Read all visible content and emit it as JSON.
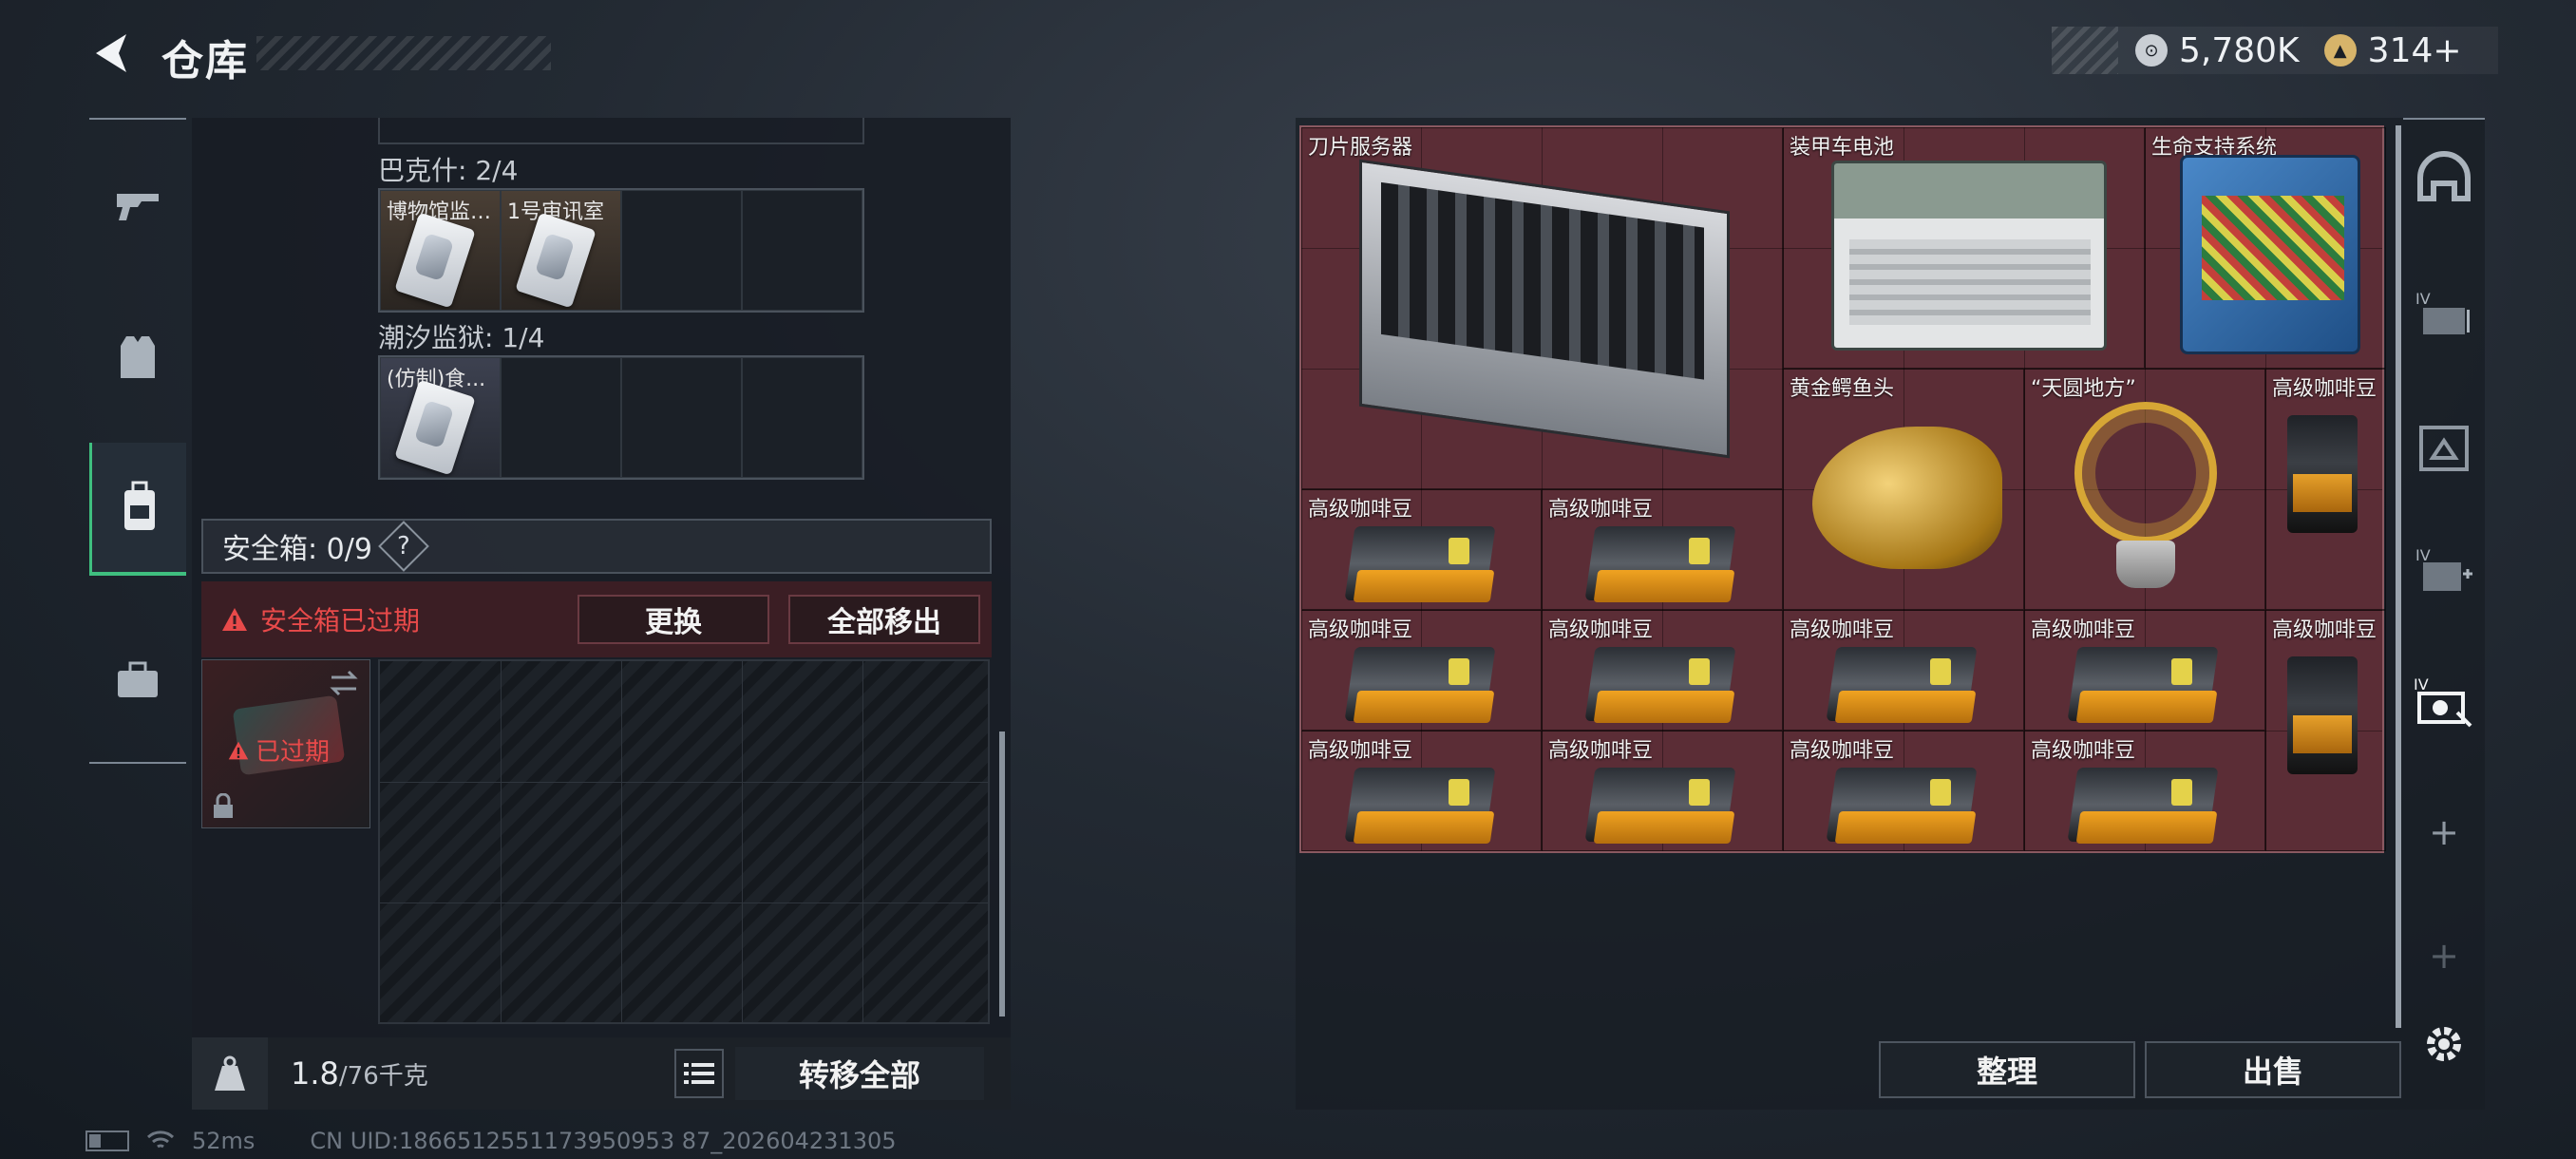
{
  "header": {
    "title": "仓库"
  },
  "currency": {
    "coins": "5,780K",
    "premium": "314+"
  },
  "nav": [
    {
      "id": "weapons",
      "icon": "gun-icon"
    },
    {
      "id": "armor",
      "icon": "vest-icon"
    },
    {
      "id": "backpack",
      "icon": "backpack-icon",
      "active": true
    },
    {
      "id": "case",
      "icon": "briefcase-icon"
    }
  ],
  "left": {
    "groups": [
      {
        "label": "巴克什: 2/4",
        "items": [
          "博物馆监控室钥匙",
          "1号审讯室"
        ]
      },
      {
        "label": "潮汐监狱: 1/4",
        "items": [
          "(仿制)食..."
        ]
      }
    ],
    "safe_box": {
      "label": "安全箱: 0/9",
      "help": "?",
      "alert": "安全箱已过期",
      "replace_btn": "更换",
      "remove_all_btn": "全部移出",
      "expired_tag": "已过期"
    },
    "weight": {
      "current": "1.8",
      "max": "/76千克"
    },
    "transfer_all": "转移全部"
  },
  "stash": {
    "items": [
      {
        "name": "刀片服务器"
      },
      {
        "name": "装甲车电池"
      },
      {
        "name": "生命支持系统"
      },
      {
        "name": "黄金鳄鱼头"
      },
      {
        "name": "“天圆地方”"
      },
      {
        "name": "高级咖啡豆"
      }
    ],
    "coffee_label": "高级咖啡豆"
  },
  "actions": {
    "sort": "整理",
    "sell": "出售"
  },
  "status": {
    "ping": "52ms",
    "uid": "CN UID:1866512551173950953 87_202604231305"
  }
}
